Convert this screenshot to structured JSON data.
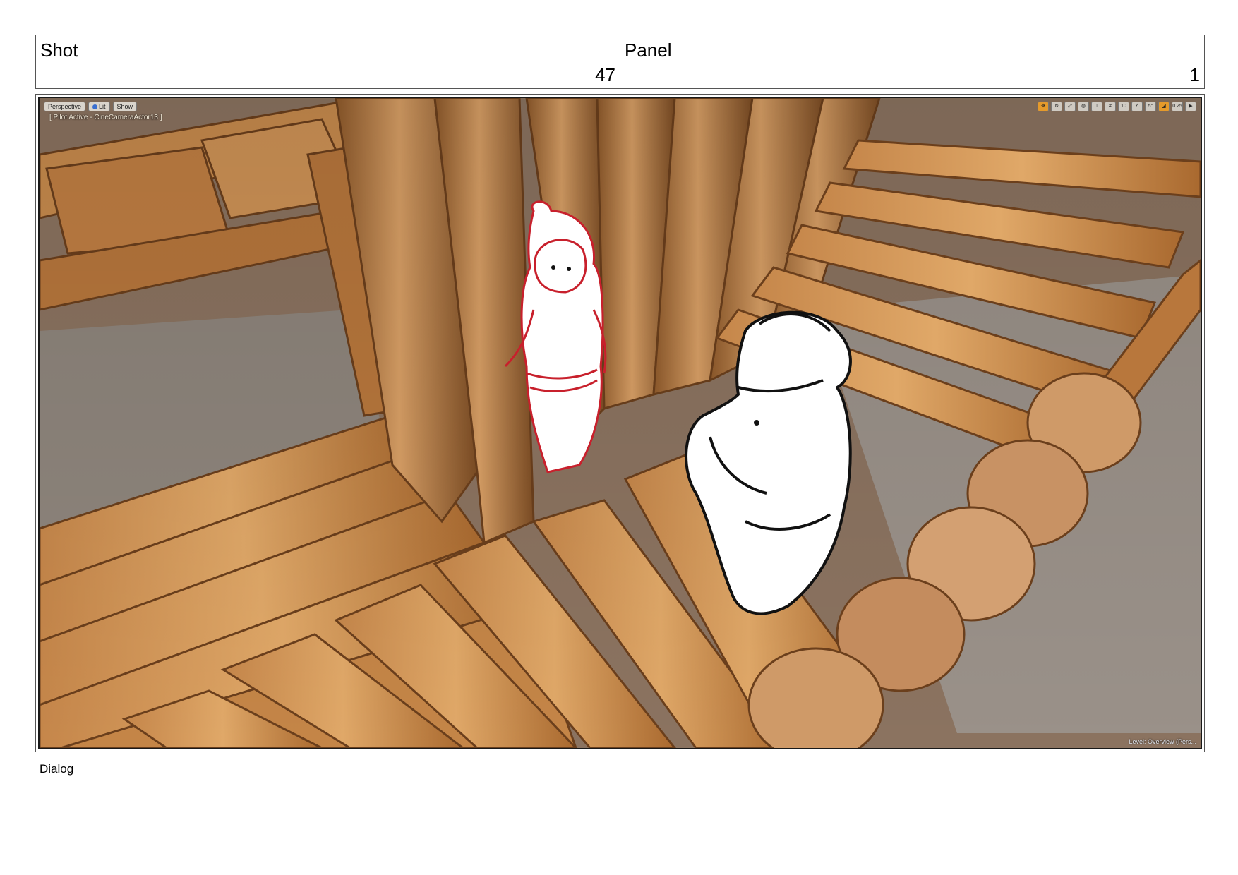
{
  "header": {
    "shot_label": "Shot",
    "shot_number": "47",
    "panel_label": "Panel",
    "panel_number": "1"
  },
  "viewport": {
    "perspective_label": "Perspective",
    "lit_label": "Lit",
    "show_label": "Show",
    "pilot_text": "[ Pilot Active - CineCameraActor13 ]",
    "grid_value": "10",
    "angle_value": "5°",
    "scale_value": "0.25",
    "level_text": "Level:  Overview (Pers..."
  },
  "footer": {
    "dialog_label": "Dialog"
  },
  "colors": {
    "wood_light": "#d89a5a",
    "wood_mid": "#b97a3e",
    "wood_dark": "#7a4a22",
    "rock": "#8e857c",
    "sketch_red": "#c8202c",
    "sketch_black": "#111111"
  }
}
